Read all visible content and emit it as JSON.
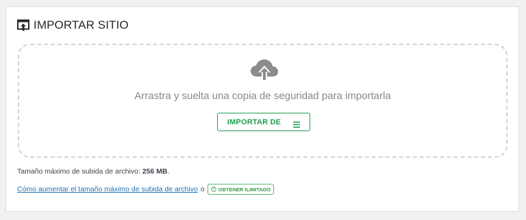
{
  "header": {
    "title": "IMPORTAR SITIO",
    "icon": "upload-box-icon"
  },
  "dropzone": {
    "icon": "cloud-upload-icon",
    "text": "Arrastra y suelta una copia de seguridad para importarla",
    "button_label": "IMPORTAR DE",
    "button_icon": "menu-icon"
  },
  "info": {
    "size_label": "Tamaño máximo de subida de archivo:",
    "size_value": "256 MB",
    "size_suffix": ".",
    "help_link": "Cómo aumentar el tamaño máximo de subida de archivo",
    "or_text": "o",
    "unlimited_label": "OBTENER ILIMITADO",
    "unlimited_icon": "power-icon"
  },
  "colors": {
    "accent_green": "#1e9e4e",
    "link_blue": "#2271b1",
    "icon_gray": "#8c8c8c"
  }
}
